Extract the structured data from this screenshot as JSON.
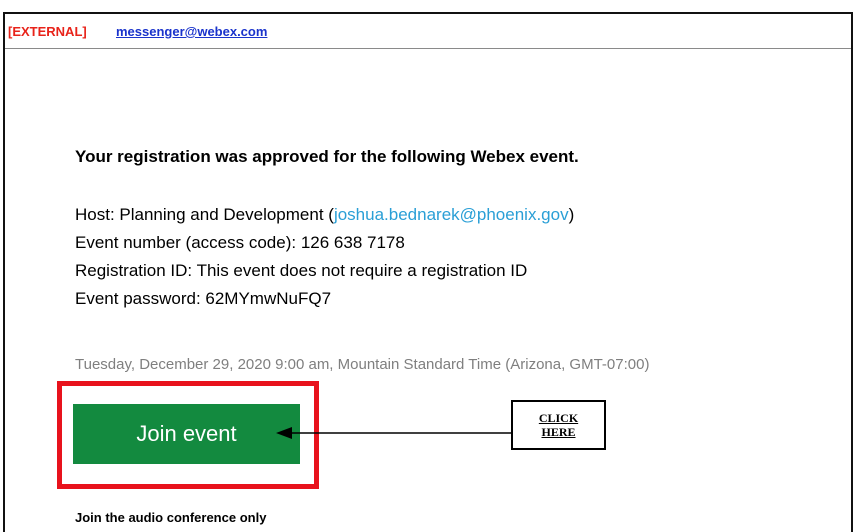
{
  "header": {
    "external_tag": "[EXTERNAL]",
    "sender": "messenger@webex.com"
  },
  "email": {
    "headline": "Your registration was approved for the following Webex event.",
    "host_prefix": "Host: Planning and Development (",
    "host_email": "joshua.bednarek@phoenix.gov",
    "host_suffix": ")",
    "event_number": "Event number (access code): 126 638 7178",
    "registration_id": "Registration ID: This event does not require a registration ID",
    "event_password": "Event password: 62MYmwNuFQ7",
    "datetime": "Tuesday, December 29, 2020 9:00 am, Mountain Standard Time (Arizona, GMT-07:00)",
    "join_button": "Join event",
    "annotation_line1": "CLICK",
    "annotation_line2": "HERE",
    "audio_heading": "Join the audio conference only"
  },
  "colors": {
    "external_tag": "#e8231a",
    "sender_link": "#1a33cc",
    "host_link": "#2a9fd6",
    "join_button_bg": "#138a3f",
    "highlight_box": "#e8121c",
    "datetime_text": "#7f7f7f"
  }
}
